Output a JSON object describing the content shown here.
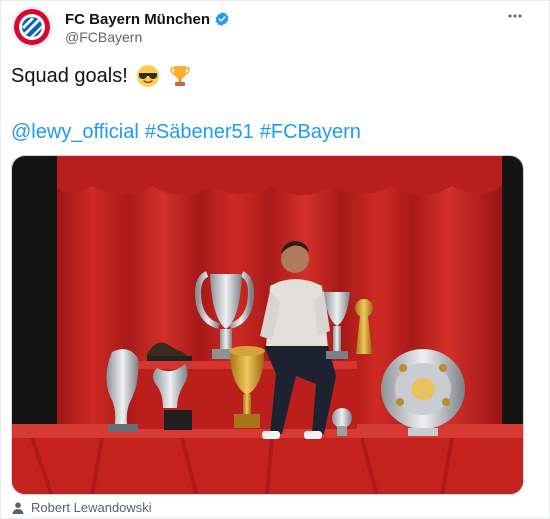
{
  "account": {
    "name": "FC Bayern München",
    "handle": "@FCBayern"
  },
  "tweet": {
    "text": "Squad goals!",
    "emojis": [
      "sunglasses-emoji",
      "trophy-emoji"
    ],
    "tags": [
      "@lewy_official",
      "#Säbener51",
      "#FCBayern"
    ]
  },
  "media": {
    "tagged_person": "Robert Lewandowski"
  },
  "colors": {
    "link": "#1d9bf0",
    "verified": "#1d9bf0",
    "curtain": "#c8201f",
    "muted": "#536471"
  }
}
